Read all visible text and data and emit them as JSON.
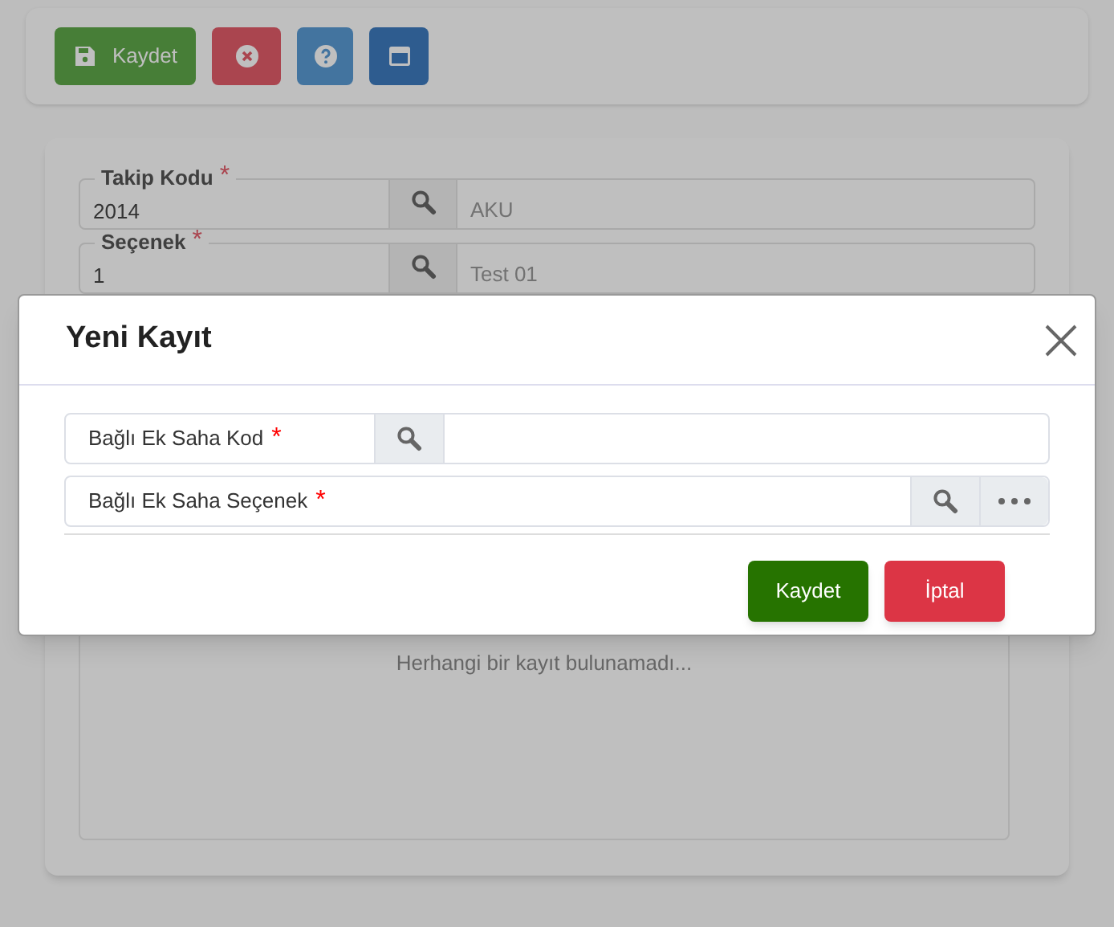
{
  "toolbar": {
    "buttons": [
      {
        "kind": "save",
        "label": "Kaydet"
      },
      {
        "kind": "cancel"
      },
      {
        "kind": "help"
      },
      {
        "kind": "window"
      }
    ]
  },
  "form": {
    "fields": [
      {
        "label": "Takip Kodu",
        "required_mark": "*",
        "value": "2014",
        "description": "AKU"
      },
      {
        "label": "Seçenek",
        "required_mark": "*",
        "value": "1",
        "description": "Test 01"
      }
    ],
    "empty_message": "Herhangi bir kayıt bulunamadı..."
  },
  "dialog": {
    "title": "Yeni Kayıt",
    "fields": [
      {
        "kind": "code",
        "label": "Bağlı Ek Saha Kod",
        "required_mark": "*"
      },
      {
        "kind": "option",
        "label": "Bağlı Ek Saha Seçenek",
        "required_mark": "*"
      }
    ],
    "buttons": [
      {
        "kind": "primary",
        "label": "Kaydet"
      },
      {
        "kind": "danger",
        "label": "İptal"
      }
    ]
  }
}
